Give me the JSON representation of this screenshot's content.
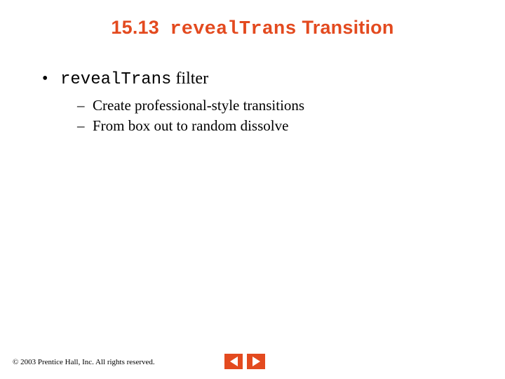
{
  "title": {
    "section_no": "15.13",
    "code": "revealTrans",
    "rest": "Transition"
  },
  "body": {
    "l1": {
      "bullet": "•",
      "code": "revealTrans",
      "after": "filter"
    },
    "l2": [
      {
        "dash": "–",
        "text": "Create professional-style transitions"
      },
      {
        "dash": "–",
        "text": "From box out to random dissolve"
      }
    ]
  },
  "footer": {
    "copyright": "© 2003 Prentice Hall, Inc.  All rights reserved."
  }
}
